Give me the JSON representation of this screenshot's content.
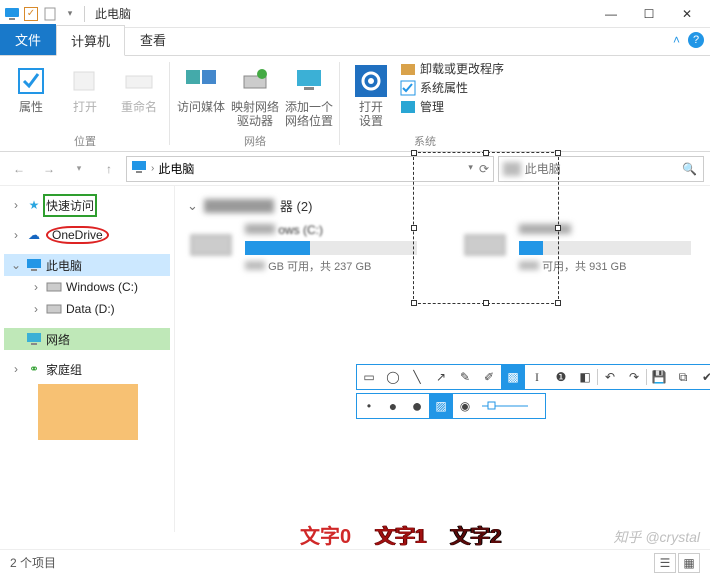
{
  "window": {
    "title": "此电脑",
    "min": "—",
    "max": "☐",
    "close": "✕"
  },
  "tabs": {
    "file": "文件",
    "computer": "计算机",
    "view": "查看"
  },
  "ribbon": {
    "loc": {
      "props": "属性",
      "open": "打开",
      "rename": "重命名",
      "group": "位置"
    },
    "net": {
      "media": "访问媒体",
      "mapdrive": "映射网络\n驱动器",
      "addloc": "添加一个\n网络位置",
      "group": "网络"
    },
    "sys": {
      "open_settings": "打开\n设置",
      "uninstall": "卸载或更改程序",
      "sysprops": "系统属性",
      "manage": "管理",
      "group": "系统"
    }
  },
  "nav": {
    "breadcrumb": "此电脑",
    "search_placeholder": "此电脑"
  },
  "tree": {
    "quick": "快速访问",
    "onedrive": "OneDrive",
    "thispc": "此电脑",
    "winc": "Windows (C:)",
    "datad": "Data (D:)",
    "network": "网络",
    "homegroup": "家庭组"
  },
  "content": {
    "section": "器 (2)",
    "drive_c": {
      "name": "ows (C:)",
      "fill_pct": 38,
      "stat": "GB 可用，共 237 GB"
    },
    "drive_d": {
      "name": "",
      "fill_pct": 14,
      "stat": "可用，共 931 GB"
    }
  },
  "bottom_labels": [
    "文字0",
    "文字1",
    "文字2"
  ],
  "bottom_colors": [
    "#d02828",
    "#a01010",
    "#5a0a0a"
  ],
  "watermark": "知乎 @crystal",
  "status": {
    "count": "2 个项目"
  }
}
